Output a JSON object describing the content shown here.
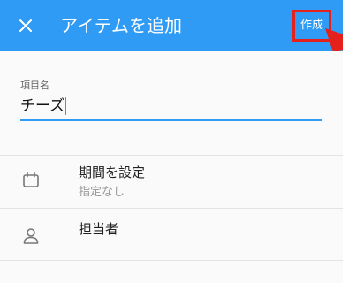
{
  "appbar": {
    "close_icon": "close-icon",
    "title": "アイテムを追加",
    "create_label": "作成",
    "color": "#2F9BF4",
    "highlight_color": "#E5211B"
  },
  "form": {
    "name_label": "項目名",
    "name_value": "チーズ"
  },
  "options": [
    {
      "icon": "calendar-icon",
      "title": "期間を設定",
      "subtitle": "指定なし"
    },
    {
      "icon": "person-icon",
      "title": "担当者",
      "subtitle": ""
    }
  ]
}
